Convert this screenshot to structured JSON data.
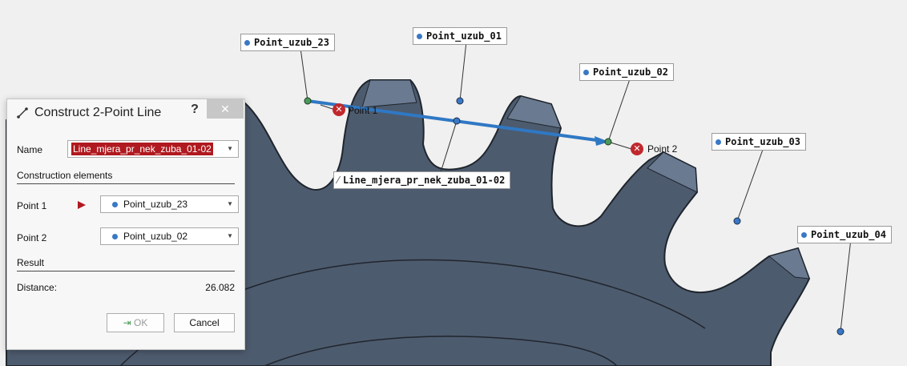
{
  "labels": {
    "point_uzub_23": "Point_uzub_23",
    "point_uzub_01": "Point_uzub_01",
    "point_uzub_02": "Point_uzub_02",
    "point_uzub_03": "Point_uzub_03",
    "point_uzub_04": "Point_uzub_04",
    "line": "Line_mjera_pr_nek_zuba_01-02",
    "point1_tag": "Point 1",
    "point2_tag": "Point 2"
  },
  "dialog": {
    "title": "Construct 2-Point Line",
    "help_label": "?",
    "close_label": "✕",
    "name_label": "Name",
    "name_value": "Line_mjera_pr_nek_zuba_01-02",
    "construction_title": "Construction elements",
    "point1_label": "Point 1",
    "point1_value": "Point_uzub_23",
    "point2_label": "Point 2",
    "point2_value": "Point_uzub_02",
    "result_title": "Result",
    "distance_label": "Distance:",
    "distance_value": "26.082",
    "ok_label": "OK",
    "cancel_label": "Cancel"
  },
  "colors": {
    "gear": "#4d5b6e",
    "tooth_tip": "#6a7a91",
    "line": "#2f78c4",
    "error": "#c0282c",
    "name_highlight": "#b0191f"
  }
}
